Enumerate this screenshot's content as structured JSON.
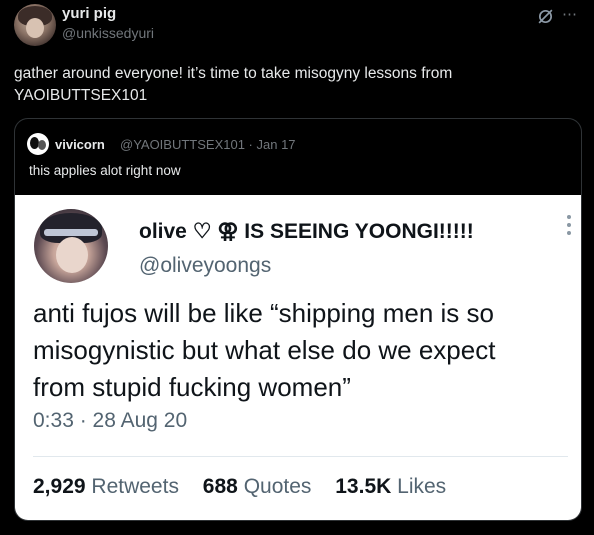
{
  "tweet": {
    "author_name": "yuri pig",
    "author_handle": "@unkissedyuri",
    "text": "gather around everyone! it’s time to take misogyny lessons from YAOIBUTTSEX101",
    "more_icon": "⋯"
  },
  "quote": {
    "author_name": "vivicorn",
    "meta": "@YAOIBUTTSEX101 · Jan 17",
    "text": "this applies alot right now"
  },
  "screenshot": {
    "name": "olive ♡ ⚢ IS SEEING YOONGI!!!!!",
    "handle": "@oliveyoongs",
    "text_line1": "anti fujos will be like “shipping men is so",
    "text_line2": "misogynistic but what else do we expect",
    "text_line3": "from stupid fucking women”",
    "timestamp": "0:33 · 28 Aug 20",
    "retweets_count": "2,929",
    "retweets_label": "Retweets",
    "quotes_count": "688",
    "quotes_label": "Quotes",
    "likes_count": "13.5K",
    "likes_label": "Likes"
  },
  "icons": {
    "grok": "grok-icon",
    "more": "more-icon",
    "screenshot_more": "vertical-more-icon"
  },
  "colors": {
    "background": "#000000",
    "text_primary": "#e7e9ea",
    "text_secondary": "#71767b",
    "card_border": "#2f3336",
    "screenshot_bg": "#ffffff",
    "screenshot_secondary": "#536471"
  }
}
